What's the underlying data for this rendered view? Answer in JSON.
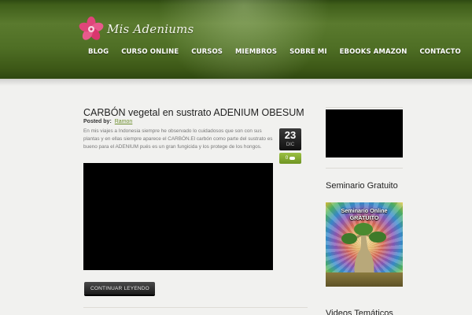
{
  "site": {
    "logo_text": "Mis Adeniums",
    "nav": [
      "BLOG",
      "CURSO ONLINE",
      "CURSOS",
      "MIEMBROS",
      "SOBRE MI",
      "EBOOKS AMAZON",
      "CONTACTO"
    ]
  },
  "post": {
    "title": "CARBÓN vegetal en sustrato ADENIUM OBESUM",
    "posted_by_label": "Posted by:",
    "author": "Ramon",
    "excerpt": "En mis viajes a Indonesia siempre he observado lo cuidadosos que son con sus plantas y en ellas siempre aparece el CARBÓN.El carbón como parte del sustrato es bueno para el ADENIUM pués es un gran fungicida y los protege de los hongos.",
    "date_day": "23",
    "date_month": "DIC",
    "comments": "0",
    "continue_label": "CONTINUAR LEYENDO"
  },
  "sidebar": {
    "seminario_title": "Seminario Gratuito",
    "seminario_image_line1": "Seminario Online",
    "seminario_image_line2": "GRATUITO",
    "next_title": "Videos Temáticos"
  },
  "colors": {
    "header_green": "#4f6f25",
    "accent_green": "#6c8e2c",
    "background": "#f1f1ef"
  }
}
